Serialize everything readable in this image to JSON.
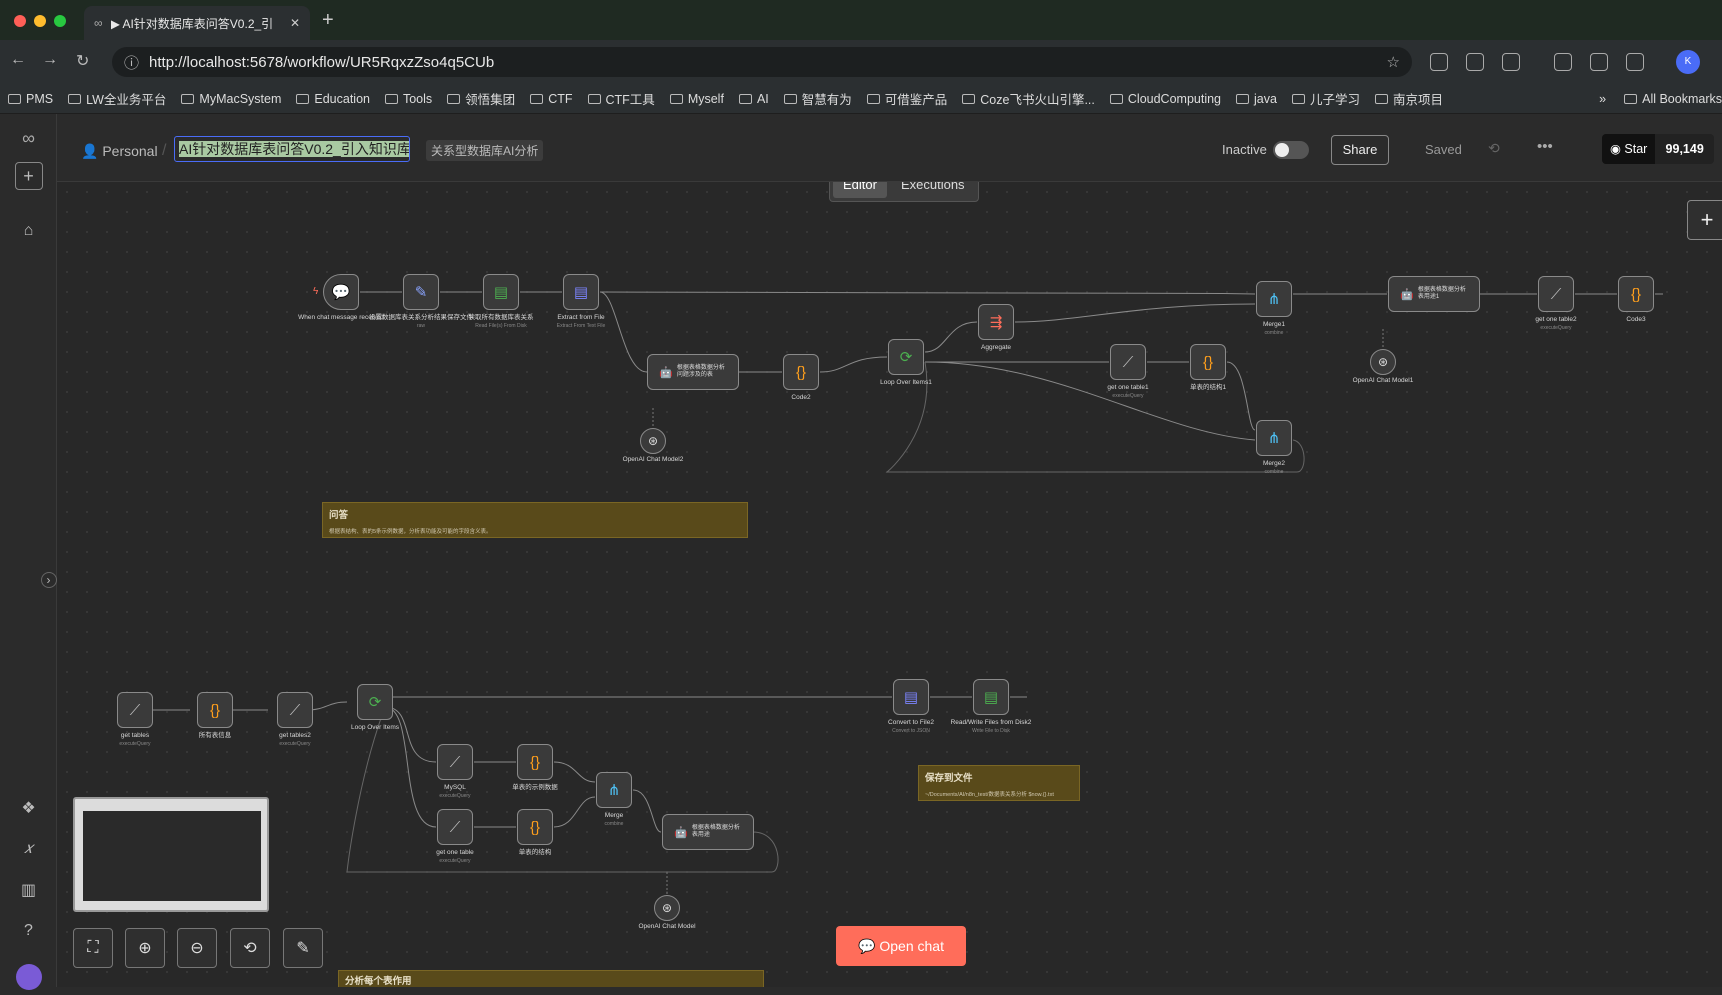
{
  "browser": {
    "tab_title": "▶ AI针对数据库表问答V0.2_引",
    "url": "http://localhost:5678/workflow/UR5RqxzZso4q5CUb",
    "bookmarks": [
      "PMS",
      "LW全业务平台",
      "MyMacSystem",
      "Education",
      "Tools",
      "领悟集团",
      "CTF",
      "CTF工具",
      "Myself",
      "AI",
      "智慧有为",
      "可借鉴产品",
      "Coze飞书火山引擎...",
      "CloudComputing",
      "java",
      "儿子学习",
      "南京项目"
    ],
    "all_bookmarks": "All Bookmarks"
  },
  "header": {
    "project": "Personal",
    "workflow_name": "AI针对数据库表问答V0.2_引入知识库",
    "tag": "关系型数据库AI分析",
    "inactive_label": "Inactive",
    "share_label": "Share",
    "saved_label": "Saved",
    "star_label": "Star",
    "star_count": "99,149",
    "tabs": [
      "Editor",
      "Executions"
    ]
  },
  "canvas": {
    "nodes_top": [
      {
        "label": "When chat message received",
        "sub": "",
        "icon": "💬"
      },
      {
        "label": "设置数据库表关系分析结果保存文件",
        "sub": "raw",
        "icon": "✎"
      },
      {
        "label": "读取所有数据库表关系",
        "sub": "Read File(s) From Disk",
        "icon": "▤"
      },
      {
        "label": "Extract from File",
        "sub": "Extract From Text File",
        "icon": "▤"
      },
      {
        "label": "根据表格数据分析问题涉及的表",
        "sub": "",
        "icon": "🤖"
      },
      {
        "label": "Code2",
        "sub": "",
        "icon": "{}"
      },
      {
        "label": "OpenAI Chat Model2",
        "sub": "",
        "icon": "⊛"
      },
      {
        "label": "Loop Over Items1",
        "sub": "",
        "icon": "⟳"
      },
      {
        "label": "Aggregate",
        "sub": "",
        "icon": "⇶"
      },
      {
        "label": "get one table1",
        "sub": "executeQuery",
        "icon": "⟋"
      },
      {
        "label": "单表的结构1",
        "sub": "",
        "icon": "{}"
      },
      {
        "label": "Merge2",
        "sub": "combine",
        "icon": "⋔"
      },
      {
        "label": "Merge1",
        "sub": "combine",
        "icon": "⋔"
      },
      {
        "label": "根据表格数据分析表用途1",
        "sub": "",
        "icon": "🤖"
      },
      {
        "label": "OpenAI Chat Model1",
        "sub": "",
        "icon": "⊛"
      },
      {
        "label": "get one table2",
        "sub": "executeQuery",
        "icon": "⟋"
      },
      {
        "label": "Code3",
        "sub": "",
        "icon": "{}"
      }
    ],
    "nodes_bottom": [
      {
        "label": "get tables",
        "sub": "executeQuery",
        "icon": "⟋"
      },
      {
        "label": "所有表信息",
        "sub": "",
        "icon": "{}"
      },
      {
        "label": "get tables2",
        "sub": "executeQuery",
        "icon": "⟋"
      },
      {
        "label": "Loop Over Items",
        "sub": "",
        "icon": "⟳"
      },
      {
        "label": "MySQL",
        "sub": "executeQuery",
        "icon": "⟋"
      },
      {
        "label": "单表的示例数据",
        "sub": "",
        "icon": "{}"
      },
      {
        "label": "get one table",
        "sub": "executeQuery",
        "icon": "⟋"
      },
      {
        "label": "单表的结构",
        "sub": "",
        "icon": "{}"
      },
      {
        "label": "Merge",
        "sub": "combine",
        "icon": "⋔"
      },
      {
        "label": "根据表格数据分析表用途",
        "sub": "",
        "icon": "🤖"
      },
      {
        "label": "OpenAI Chat Model",
        "sub": "",
        "icon": "⊛"
      },
      {
        "label": "Convert to File2",
        "sub": "Convert to JSON",
        "icon": "▤"
      },
      {
        "label": "Read/Write Files from Disk2",
        "sub": "Write File to Disk",
        "icon": "▤"
      }
    ],
    "sticky_qa_title": "问答",
    "sticky_qa_body": "根据表结构、表的5条示例数据，分析表功能及可能的字段含义表。",
    "sticky_save_title": "保存到文件",
    "sticky_save_body": "~/Documents/AI/n8n_test/数据表关系分析 $now.{}.txt",
    "sticky_analyze_title": "分析每个表作用",
    "open_chat_label": "Open chat"
  }
}
